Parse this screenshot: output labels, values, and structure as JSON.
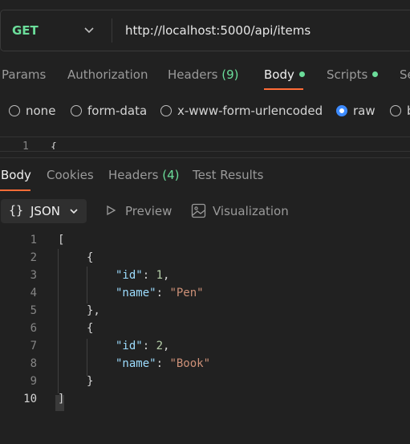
{
  "request": {
    "method": "GET",
    "url": "http://localhost:5000/api/items"
  },
  "request_tabs": [
    {
      "label": "Params"
    },
    {
      "label": "Authorization"
    },
    {
      "label": "Headers",
      "count": "(9)"
    },
    {
      "label": "Body",
      "active": true,
      "dot": true
    },
    {
      "label": "Scripts",
      "dot": true
    },
    {
      "label": "Se"
    }
  ],
  "body_types": [
    {
      "label": "none"
    },
    {
      "label": "form-data"
    },
    {
      "label": "x-www-form-urlencoded"
    },
    {
      "label": "raw",
      "selected": true
    },
    {
      "label": "b"
    }
  ],
  "request_editor": {
    "line": "1",
    "text": "{"
  },
  "response_tabs": [
    {
      "label": "Body",
      "active": true
    },
    {
      "label": "Cookies"
    },
    {
      "label": "Headers",
      "count": "(4)"
    },
    {
      "label": "Test Results"
    }
  ],
  "response_view": {
    "format_icon": "{}",
    "format_label": "JSON",
    "preview_label": "Preview",
    "visualization_label": "Visualization"
  },
  "response_code": [
    {
      "n": "1",
      "text": "["
    },
    {
      "n": "2",
      "text": "{"
    },
    {
      "n": "3",
      "key": "\"id\"",
      "value": "1",
      "vtype": "num",
      "trail": ","
    },
    {
      "n": "4",
      "key": "\"name\"",
      "value": "\"Pen\"",
      "vtype": "str",
      "trail": ""
    },
    {
      "n": "5",
      "text": "},"
    },
    {
      "n": "6",
      "text": "{"
    },
    {
      "n": "7",
      "key": "\"id\"",
      "value": "2",
      "vtype": "num",
      "trail": ","
    },
    {
      "n": "8",
      "key": "\"name\"",
      "value": "\"Book\"",
      "vtype": "str",
      "trail": ""
    },
    {
      "n": "9",
      "text": "}"
    },
    {
      "n": "10",
      "text": "]"
    }
  ],
  "colors": {
    "accent": "#ff6c37",
    "green": "#6bdd9a",
    "radio_on": "#3d8bff"
  }
}
